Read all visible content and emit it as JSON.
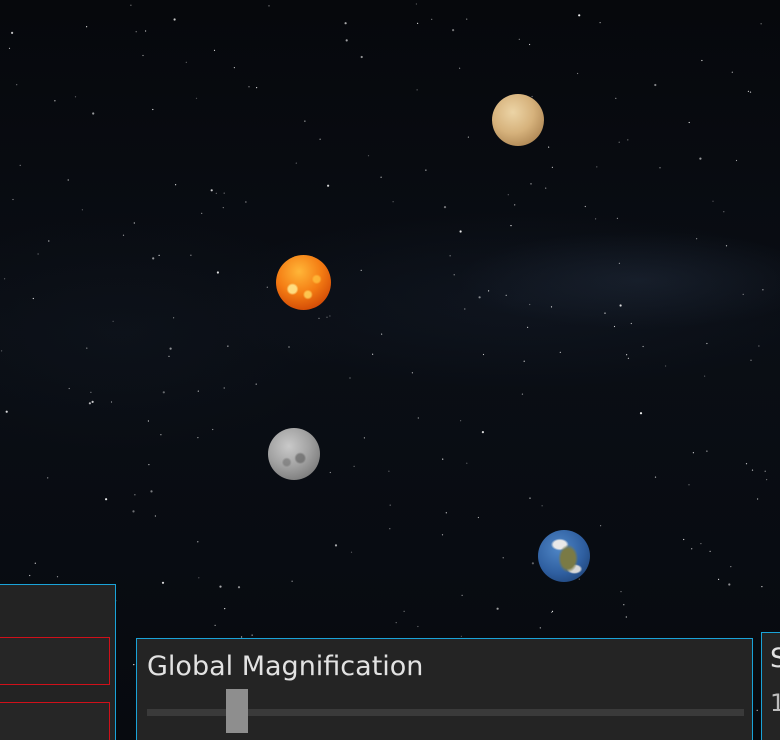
{
  "scene": {
    "planets": [
      {
        "id": "venus",
        "icon": "venus-planet-icon"
      },
      {
        "id": "sun",
        "icon": "sun-icon"
      },
      {
        "id": "mercury",
        "icon": "mercury-planet-icon"
      },
      {
        "id": "earth",
        "icon": "earth-planet-icon"
      }
    ]
  },
  "magnification": {
    "label": "Global Magnification",
    "slider_fraction": 0.15
  },
  "right_panel": {
    "label": "S",
    "value": "1"
  },
  "colors": {
    "panel_border": "#1aa3d8",
    "panel_background": "#242424",
    "field_border_error": "#d0101a",
    "slider_thumb": "#8e8e8e"
  }
}
